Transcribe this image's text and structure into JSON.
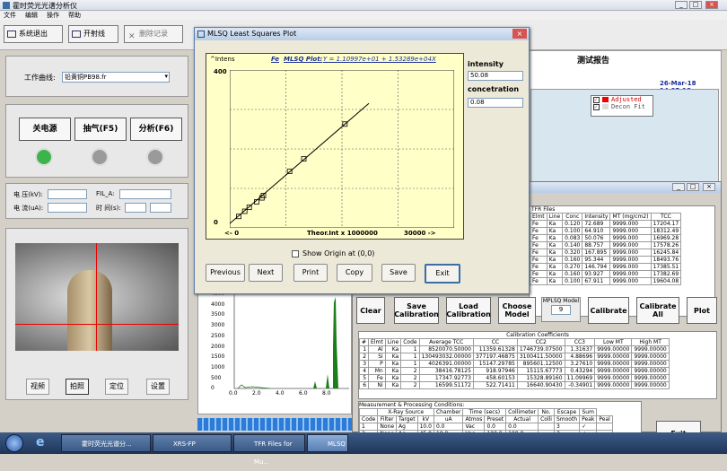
{
  "app": {
    "title": "霍时荧光光谱分析仪",
    "menu": [
      "文件",
      "编辑",
      "操作",
      "帮助"
    ]
  },
  "toolbar": {
    "exit": "系统退出",
    "start": "开射线",
    "delete": "删除记录"
  },
  "left": {
    "curve_label": "工作曲线:",
    "curve_value": "铅黄铜PB98.fr",
    "power": "关电源",
    "pump": "抽气(F5)",
    "analyze": "分析(F6)",
    "voltage": "电 压(kV):",
    "current": "电 流(uA):",
    "fil": "FIL_A:",
    "time": "时 间(s):",
    "video": "视频",
    "capture": "拍照",
    "locate": "定位",
    "settings": "设置"
  },
  "report": {
    "title": "测试报告",
    "date": "26-Mar-18 14:05:18",
    "legend": [
      "Adjusted",
      "Decon Fit"
    ]
  },
  "spectrum": {
    "y_ticks": [
      "4500",
      "4000",
      "3500",
      "3000",
      "2500",
      "2000",
      "1500",
      "1000",
      "500",
      "0"
    ],
    "x_ticks": [
      "0.0",
      "2.0",
      "4.0",
      "6.0",
      "8.0"
    ]
  },
  "dialog": {
    "title": "MLSQ Least Squares Plot",
    "element": "Fe",
    "plot_label": "MLSQ Plot:",
    "equation": "Y = 1.10997e+01 + 1.53289e+04X",
    "y_label": "^Intens",
    "y_max": "400",
    "y_min": "0",
    "x_label": "Theor.Int x 1000000",
    "x_left": "<-  0",
    "x_right": "30000  ->",
    "intensity_label": "intensity",
    "intensity_value": "50.08",
    "conc_label": "concetration",
    "conc_value": "0.08",
    "show_origin": "Show Origin at (0,0)",
    "buttons": [
      "Previous",
      "Next",
      "Print",
      "Copy",
      "Save",
      "Exit"
    ]
  },
  "chart_data": {
    "type": "scatter",
    "x": [
      1200,
      2000,
      2600,
      3600,
      4300,
      4500,
      8000,
      9900,
      15400
    ],
    "y": [
      29,
      42,
      52,
      66,
      76,
      82,
      143,
      175,
      263
    ],
    "xlim": [
      0,
      30000
    ],
    "ylim": [
      0,
      400
    ]
  },
  "tfr": {
    "title": "TFR Files",
    "headers": [
      "Elmt",
      "Line",
      "Conc",
      "Intensity",
      "MT (mg/cm2)",
      "TCC"
    ],
    "rows": [
      [
        "Fe",
        "Ka",
        "0.120",
        "72.689",
        "9999.000",
        "17204.17"
      ],
      [
        "Fe",
        "Ka",
        "0.100",
        "64.910",
        "9999.000",
        "18312.49"
      ],
      [
        "Fe",
        "Ka",
        "0.083",
        "50.076",
        "9999.000",
        "16969.28"
      ],
      [
        "Fe",
        "Ka",
        "0.140",
        "88.757",
        "9999.000",
        "17578.26"
      ],
      [
        "Fe",
        "Ka",
        "0.320",
        "167.895",
        "9999.000",
        "16245.84"
      ],
      [
        "Fe",
        "Ka",
        "0.160",
        "95.344",
        "9999.000",
        "18493.76"
      ],
      [
        "Fe",
        "Ka",
        "0.270",
        "146.794",
        "9999.000",
        "17385.51"
      ],
      [
        "Fe",
        "Ka",
        "0.160",
        "93.927",
        "9999.000",
        "17382.69"
      ],
      [
        "Fe",
        "Ka",
        "0.100",
        "67.911",
        "9999.000",
        "19604.08"
      ]
    ]
  },
  "cal_buttons": {
    "clear": "Clear",
    "save": "Save Calibration",
    "load": "Load Calibration",
    "choose": "Choose Model",
    "mlsq": "MPLSQ Model",
    "mlsq_value": "9",
    "calibrate": "Calibrate",
    "calibrate_all": "Calibrate All",
    "plot": "Plot"
  },
  "coef": {
    "title": "Calibration Coefficients",
    "headers": [
      "#",
      "Elmt",
      "Line",
      "Code",
      "Average TCC",
      "CC",
      "CC2",
      "CC3",
      "Low MT",
      "High MT"
    ],
    "rows": [
      [
        "1",
        "Al",
        "Ka",
        "1",
        "8520070.50000",
        "11359.61328",
        "1746739.07500",
        "1.31637",
        "9999.00000",
        "9999.00000"
      ],
      [
        "2",
        "Si",
        "Ka",
        "1",
        "130493032.00000",
        "377197.46875",
        "3100411.50000",
        "4.88696",
        "9999.00000",
        "9999.00000"
      ],
      [
        "3",
        "P",
        "Ka",
        "1",
        "4026391.00000",
        "15147.29785",
        "895601.12500",
        "3.27610",
        "9999.00000",
        "9999.00000"
      ],
      [
        "4",
        "Mn",
        "Ka",
        "2",
        "38416.78125",
        "918.97946",
        "15115.67773",
        "0.43294",
        "9999.00000",
        "9999.00000"
      ],
      [
        "5",
        "Fe",
        "Ka",
        "2",
        "17347.92773",
        "458.60153",
        "15328.89160",
        "11.09969",
        "9999.00000",
        "9999.00000"
      ],
      [
        "6",
        "Ni",
        "Ka",
        "2",
        "16599.51172",
        "522.71411",
        "16640.90430",
        "-0.34901",
        "9999.00000",
        "9999.00000"
      ]
    ]
  },
  "meas": {
    "title": "Measurement & Processing Conditions:",
    "groups": [
      "X-Ray Source",
      "Chamber",
      "Time (secs)",
      "Collimeter",
      "No.",
      "Escape",
      "Sum"
    ],
    "headers": [
      "Code",
      "Filter",
      "Target",
      "kV",
      "uA",
      "Atmos",
      "Preset",
      "Actual",
      "Colli",
      "Smooth",
      "Peak",
      "Peal"
    ],
    "rows": [
      [
        "1",
        "None",
        "Ag",
        "10.0",
        "0.0",
        "Vac",
        "0.0",
        "0.0",
        "",
        "3",
        "✓",
        ""
      ],
      [
        "2",
        "None",
        "Ag",
        "45.0",
        "10.0",
        "Vac",
        "100.0",
        "100.0",
        "",
        "3",
        "✓",
        ""
      ]
    ],
    "exit": "Exit"
  },
  "taskbar": {
    "items": [
      "霍时荧光光谱分...",
      "XRS-FP",
      "TFR Files for Mu...",
      "MLSQ"
    ]
  }
}
